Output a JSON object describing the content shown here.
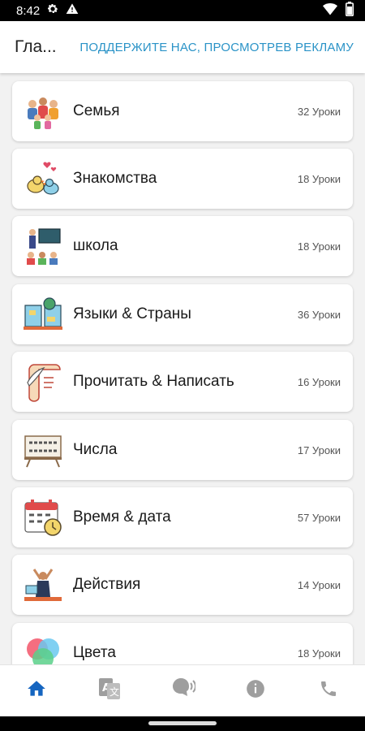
{
  "status_bar": {
    "time": "8:42",
    "icons": [
      "settings-icon",
      "warning-icon",
      "wifi-icon",
      "battery-icon"
    ]
  },
  "app_bar": {
    "title": "Гла...",
    "action": "ПОДДЕРЖИТЕ НАС, ПРОСМОТРЕВ РЕКЛАМУ"
  },
  "categories": [
    {
      "title": "Семья",
      "count": "32 Уроки",
      "icon": "family-icon"
    },
    {
      "title": "Знакомства",
      "count": "18 Уроки",
      "icon": "birds-love-icon"
    },
    {
      "title": "школа",
      "count": "18 Уроки",
      "icon": "school-icon"
    },
    {
      "title": "Языки & Страны",
      "count": "36 Уроки",
      "icon": "languages-book-icon"
    },
    {
      "title": "Прочитать & Написать",
      "count": "16 Уроки",
      "icon": "scroll-quill-icon"
    },
    {
      "title": "Числа",
      "count": "17 Уроки",
      "icon": "numbers-board-icon"
    },
    {
      "title": "Время & дата",
      "count": "57 Уроки",
      "icon": "calendar-clock-icon"
    },
    {
      "title": "Действия",
      "count": "14 Уроки",
      "icon": "actions-person-icon"
    },
    {
      "title": "Цвета",
      "count": "18 Уроки",
      "icon": "colors-icon"
    }
  ],
  "bottom_nav": [
    {
      "name": "home-icon",
      "active": true
    },
    {
      "name": "translate-icon",
      "active": false
    },
    {
      "name": "speak-icon",
      "active": false
    },
    {
      "name": "info-icon",
      "active": false
    },
    {
      "name": "phone-icon",
      "active": false
    }
  ],
  "colors": {
    "accent": "#2a93c7",
    "nav_active": "#1565c0",
    "nav_inactive": "#9e9e9e"
  }
}
